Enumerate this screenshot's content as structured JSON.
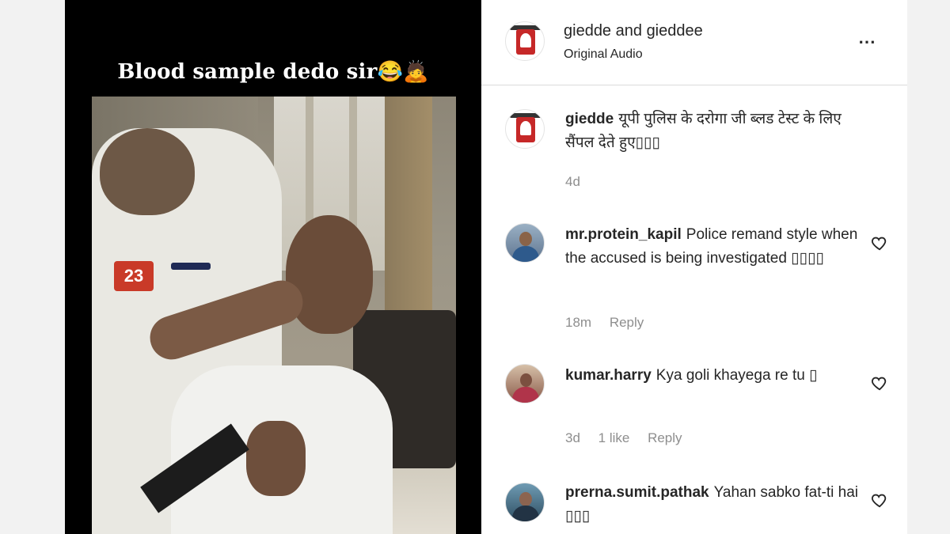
{
  "video": {
    "overlay_caption": "Blood sample dedo sir😂🙇",
    "badge_number": "23"
  },
  "post_header": {
    "author": "giedde",
    "collaborator_joiner": "and",
    "collaborator": "gieddee",
    "audio_label": "Original Audio",
    "more_icon": "⋯"
  },
  "caption": {
    "username": "giedde",
    "text": "यूपी पुलिस के दरोगा जी ब्लड टेस्ट के लिए सैंपल देते हुए▯▯▯",
    "time": "4d"
  },
  "comments": [
    {
      "username": "mr.protein_kapil",
      "text": "Police remand style when the accused is being investigated ▯▯▯▯",
      "time": "18m",
      "likes": "",
      "reply": "Reply"
    },
    {
      "username": "kumar.harry",
      "text": "Kya goli khayega re tu ▯",
      "time": "3d",
      "likes": "1 like",
      "reply": "Reply"
    },
    {
      "username": "prerna.sumit.pathak",
      "text": "Yahan sabko fat-ti hai ▯▯▯",
      "time": "",
      "likes": "",
      "reply": ""
    }
  ],
  "icons": {
    "more": "more-options-icon",
    "like": "heart-icon"
  }
}
